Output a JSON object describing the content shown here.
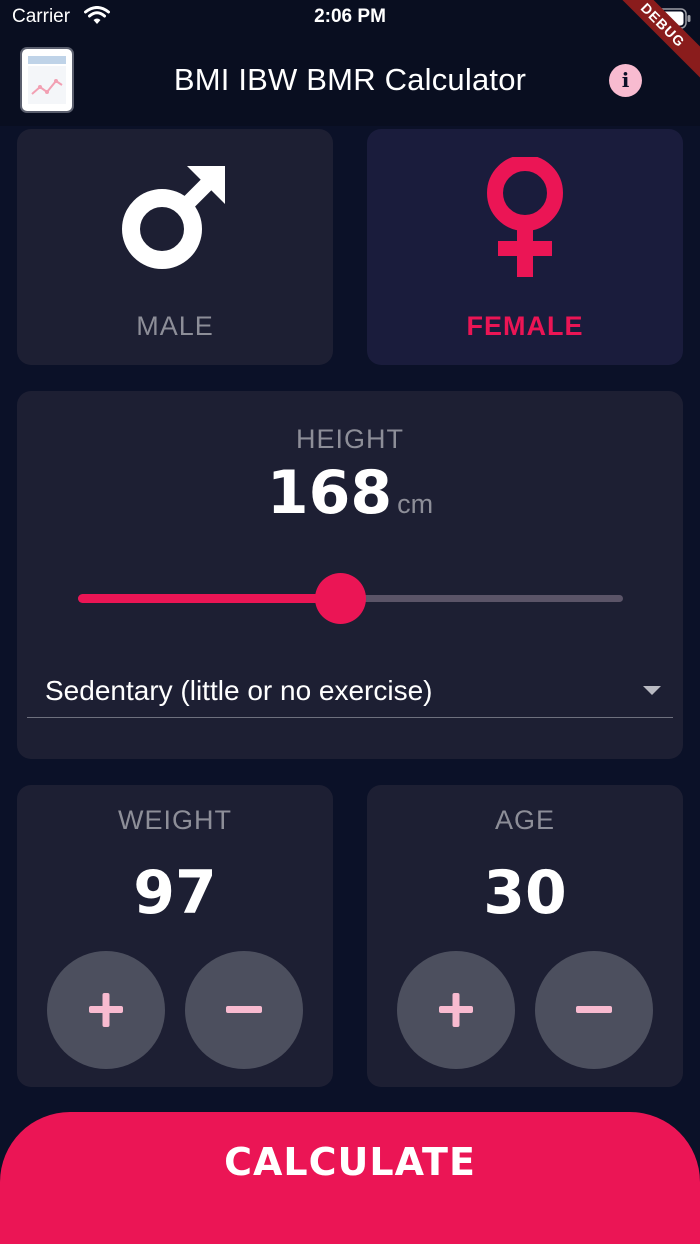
{
  "status_bar": {
    "carrier": "Carrier",
    "time": "2:06 PM",
    "icons": [
      "wifi-icon",
      "battery-icon"
    ]
  },
  "app_bar": {
    "title": "BMI IBW BMR Calculator",
    "logo_icon": "chart-logo-icon",
    "info_glyph": "i",
    "debug_banner": "DEBUG"
  },
  "gender": {
    "male": {
      "label": "MALE",
      "icon": "male-symbol-icon",
      "selected": false
    },
    "female": {
      "label": "FEMALE",
      "icon": "female-symbol-icon",
      "selected": true
    }
  },
  "height": {
    "label": "HEIGHT",
    "value": "168",
    "unit": "cm",
    "slider_fraction": 0.48
  },
  "activity": {
    "selected": "Sedentary (little or no exercise)"
  },
  "weight": {
    "label": "WEIGHT",
    "value": "97",
    "increment_icon": "plus-icon",
    "decrement_icon": "minus-icon"
  },
  "age": {
    "label": "AGE",
    "value": "30",
    "increment_icon": "plus-icon",
    "decrement_icon": "minus-icon"
  },
  "calculate": {
    "label": "CALCULATE"
  },
  "colors": {
    "background": "#0B1128",
    "card": "#1D1F33",
    "card_selected": "#1A1C3C",
    "accent": "#EB1555",
    "accent_light": "#F8BBD0",
    "muted_text": "#8D8E98",
    "button": "#4C4F5E"
  }
}
